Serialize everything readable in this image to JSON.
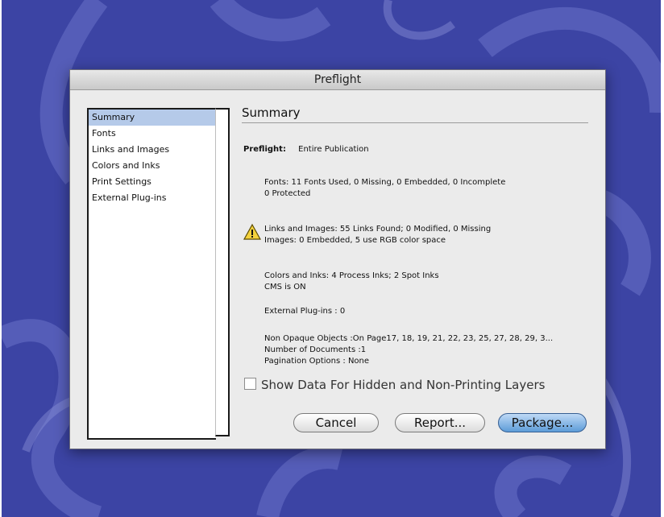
{
  "dialog": {
    "title": "Preflight"
  },
  "sidebar": {
    "items": [
      {
        "label": "Summary",
        "selected": true
      },
      {
        "label": "Fonts"
      },
      {
        "label": "Links and Images"
      },
      {
        "label": "Colors and Inks"
      },
      {
        "label": "Print Settings"
      },
      {
        "label": "External Plug-ins"
      }
    ]
  },
  "summary": {
    "title": "Summary",
    "preflight_label": "Preflight:",
    "preflight_value": "Entire Publication",
    "fonts_line1": "Fonts: 11 Fonts Used, 0 Missing, 0 Embedded, 0 Incomplete",
    "fonts_line2": "0 Protected",
    "links_line1": "Links and Images: 55 Links Found; 0 Modified, 0 Missing",
    "links_line2": "Images: 0 Embedded, 5 use RGB color space",
    "warning_icon": "warning-triangle-icon",
    "colors_line1": "Colors and Inks: 4 Process Inks; 2 Spot Inks",
    "colors_line2": "CMS is ON",
    "plugins_line": "External Plug-ins : 0",
    "nonopaque_line": "Non Opaque Objects :On Page17, 18, 19, 21, 22, 23, 25, 27, 28, 29, 3...",
    "documents_line": "Number of Documents :1",
    "pagination_line": "Pagination Options : None"
  },
  "options": {
    "show_hidden_label": "Show Data For Hidden and Non-Printing Layers",
    "show_hidden_checked": false
  },
  "buttons": {
    "cancel": "Cancel",
    "report": "Report...",
    "package": "Package..."
  },
  "colors": {
    "background": "#3c44a4",
    "selection": "#b5cae9",
    "primary_button": "#5d9cd8"
  }
}
